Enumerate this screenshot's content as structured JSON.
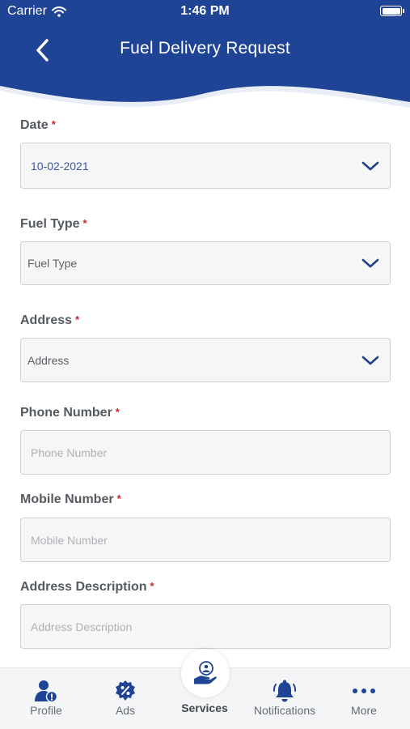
{
  "status_bar": {
    "carrier": "Carrier",
    "time": "1:46 PM"
  },
  "header": {
    "title": "Fuel Delivery Request",
    "back_icon": "chevron-left-icon"
  },
  "form": {
    "date": {
      "label": "Date",
      "value": "10-02-2021"
    },
    "fuel_type": {
      "label": "Fuel Type",
      "value": "Fuel Type"
    },
    "address": {
      "label": "Address",
      "value": "Address"
    },
    "phone": {
      "label": "Phone Number",
      "placeholder": "Phone Number"
    },
    "mobile": {
      "label": "Mobile Number",
      "placeholder": "Mobile Number"
    },
    "address_description": {
      "label": "Address Description",
      "placeholder": "Address Description"
    }
  },
  "required_mark": "*",
  "tabbar": {
    "profile": "Profile",
    "ads": "Ads",
    "services": "Services",
    "notifications": "Notifications",
    "more": "More"
  },
  "colors": {
    "brand": "#1f4496",
    "required": "#d0202e",
    "date_value": "#3a57a0",
    "placeholder": "#aeb1b6"
  }
}
